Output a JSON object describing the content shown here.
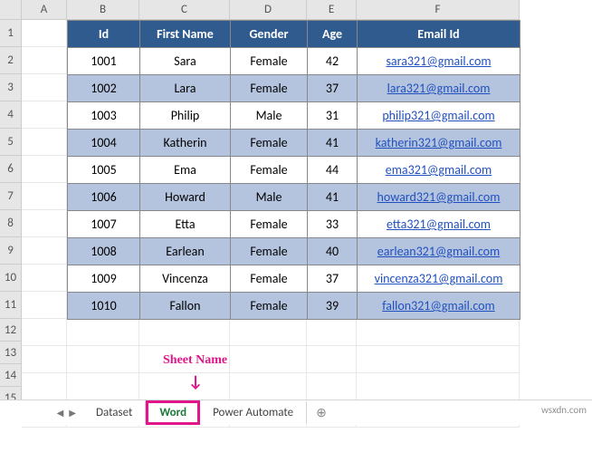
{
  "columns": {
    "A": "A",
    "B": "B",
    "C": "C",
    "D": "D",
    "E": "E",
    "F": "F"
  },
  "col_widths": {
    "A": 50,
    "B": 80,
    "C": 100,
    "D": 85,
    "E": 55,
    "F": 180
  },
  "row_labels": [
    "1",
    "2",
    "3",
    "4",
    "5",
    "6",
    "7",
    "8",
    "9",
    "10",
    "11",
    "12",
    "13",
    "14",
    "15"
  ],
  "headers": {
    "id": "Id",
    "first": "First Name",
    "gender": "Gender",
    "age": "Age",
    "email": "Email Id"
  },
  "rows": [
    {
      "id": "1001",
      "first": "Sara",
      "gender": "Female",
      "age": "42",
      "email": "sara321@gmail.com"
    },
    {
      "id": "1002",
      "first": "Lara",
      "gender": "Female",
      "age": "37",
      "email": "lara321@gmail.com"
    },
    {
      "id": "1003",
      "first": "Philip",
      "gender": "Male",
      "age": "31",
      "email": "philip321@gmail.com"
    },
    {
      "id": "1004",
      "first": "Katherin",
      "gender": "Female",
      "age": "41",
      "email": "katherin321@gmail.com"
    },
    {
      "id": "1005",
      "first": "Ema",
      "gender": "Female",
      "age": "44",
      "email": "ema321@gmail.com"
    },
    {
      "id": "1006",
      "first": "Howard",
      "gender": "Male",
      "age": "41",
      "email": "howard321@gmail.com"
    },
    {
      "id": "1007",
      "first": "Etta",
      "gender": "Female",
      "age": "33",
      "email": "etta321@gmail.com"
    },
    {
      "id": "1008",
      "first": "Earlean",
      "gender": "Female",
      "age": "40",
      "email": "earlean321@gmail.com"
    },
    {
      "id": "1009",
      "first": "Vincenza",
      "gender": "Female",
      "age": "37",
      "email": "vincenza321@gmail.com"
    },
    {
      "id": "1010",
      "first": "Fallon",
      "gender": "Female",
      "age": "39",
      "email": "fallon321@gmail.com"
    }
  ],
  "tabs": {
    "0": "Dataset",
    "1": "Word",
    "2": "Power Automate"
  },
  "annotation": {
    "label": "Sheet Name",
    "arrow": "↓"
  },
  "tab_add": "⊕",
  "watermark": "wsxdn.com"
}
